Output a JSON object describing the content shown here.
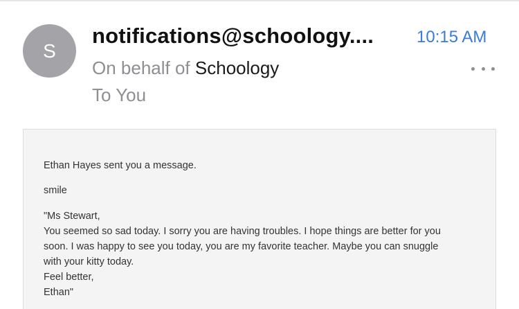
{
  "header": {
    "avatar_initial": "S",
    "sender": "notifications@schoology....",
    "time": "10:15 AM",
    "behalf_prefix": "On behalf of ",
    "behalf_org": "Schoology",
    "to_line": "To You",
    "more_icon": "ellipsis-icon"
  },
  "message": {
    "intro": "Ethan Hayes sent you a message.",
    "subject": "smile",
    "lines": [
      "\"Ms Stewart,",
      "You seemed so sad today. I sorry you are having troubles. I hope things are better for you",
      "soon. I was happy to see you today, you are my favorite teacher. Maybe you can snuggle",
      "with your kitty today.",
      "Feel better,",
      "Ethan\""
    ]
  },
  "colors": {
    "time_accent": "#3a7bd5",
    "avatar_bg": "#a3a3a8",
    "message_bg": "#f4f4f4"
  }
}
